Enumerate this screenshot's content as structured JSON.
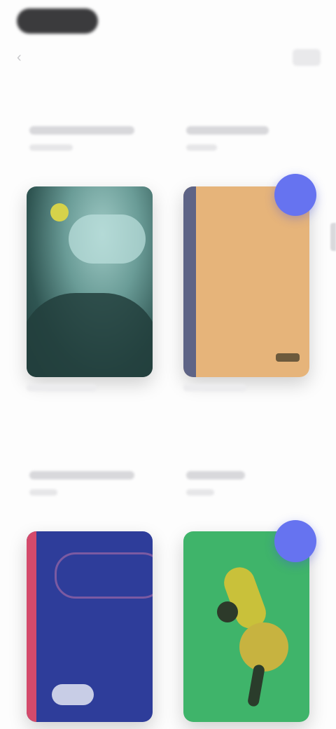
{
  "header": {
    "back_icon": "‹",
    "pill_color": "#3b3b3d"
  },
  "books": [
    {
      "cover_style": "teal-landscape",
      "has_badge": false,
      "badge_color": null
    },
    {
      "cover_style": "tan-plain",
      "has_badge": true,
      "badge_color": "#6673f0"
    },
    {
      "cover_style": "blue-abstract",
      "has_badge": false,
      "badge_color": null
    },
    {
      "cover_style": "green-figure",
      "has_badge": true,
      "badge_color": "#6673f0"
    }
  ],
  "colors": {
    "background": "#fdfdfd",
    "badge": "#6673f0",
    "placeholder": "#d8d8db"
  }
}
